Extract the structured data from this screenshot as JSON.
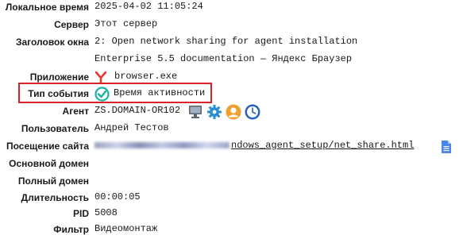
{
  "fields": {
    "local_time": {
      "label": "Локальное время",
      "value": "2025-04-02 11:05:24"
    },
    "server": {
      "label": "Сервер",
      "value": "Этот сервер"
    },
    "window_title": {
      "label": "Заголовок окна",
      "value_line1": "2: Open network sharing for agent installation",
      "value_line2": "Enterprise 5.5 documentation — Яндекс Браузер"
    },
    "application": {
      "label": "Приложение",
      "value": "browser.exe",
      "icon": "yandex-browser-icon"
    },
    "event_type": {
      "label": "Тип события",
      "value": "Время активности",
      "icon": "check-circle-icon"
    },
    "agent": {
      "label": "Агент",
      "value": "ZS.DOMAIN-OR102",
      "icons": [
        "computer-icon",
        "settings-gear-icon",
        "user-icon",
        "clock-icon"
      ]
    },
    "user": {
      "label": "Пользователь",
      "value": "Андрей Тестов"
    },
    "site_visit": {
      "label": "Посещение сайта",
      "value_visible": "ndows_agent_setup/net_share.html",
      "icon": "document-icon"
    },
    "primary_domain": {
      "label": "Основной домен",
      "value": ""
    },
    "full_domain": {
      "label": "Полный домен",
      "value": ""
    },
    "duration": {
      "label": "Длительность",
      "value": "00:00:05"
    },
    "pid": {
      "label": "PID",
      "value": "5008"
    },
    "filter": {
      "label": "Фильтр",
      "value": "Видеомонтаж"
    }
  },
  "colors": {
    "highlight_border": "#d9232a",
    "check_teal": "#17b3a3",
    "gear_blue": "#2a8fd0",
    "user_orange": "#f0a030",
    "clock_blue": "#2563b8",
    "doc_blue": "#4a86e8"
  }
}
